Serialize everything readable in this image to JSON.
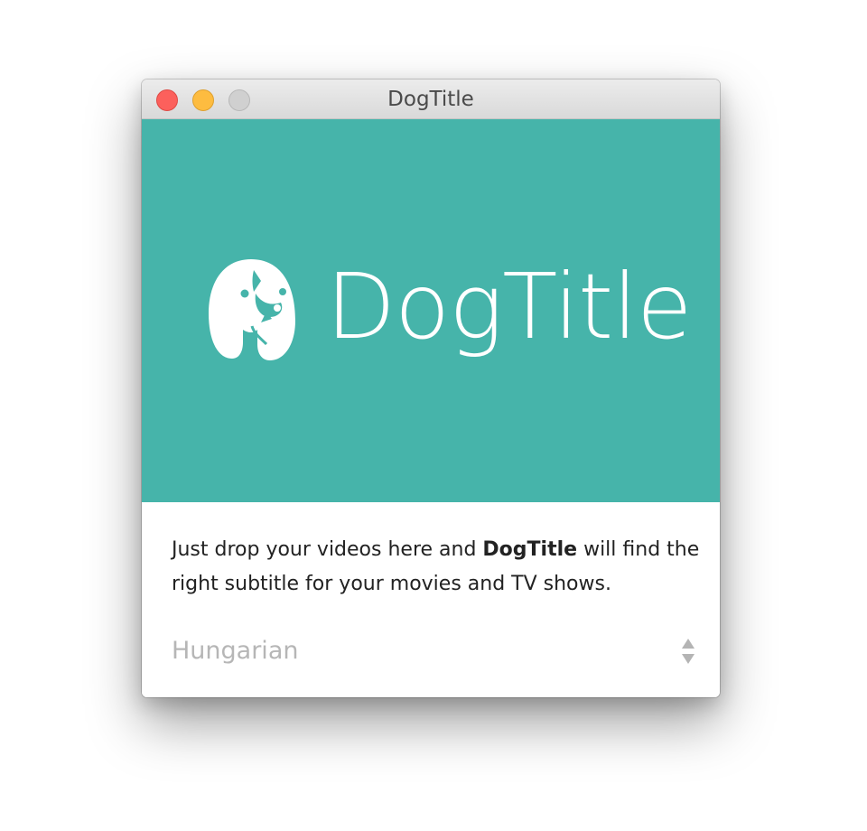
{
  "window": {
    "title": "DogTitle"
  },
  "hero": {
    "logo_icon": "dog-head-icon",
    "logo_text": "DogTitle",
    "background_color": "#46b4aa"
  },
  "description": {
    "before": "Just drop your videos here and ",
    "brand": "DogTitle",
    "after": " will find the right subtitle for your movies and TV shows."
  },
  "language_select": {
    "value": "Hungarian",
    "icon": "up-down-arrows-icon"
  }
}
